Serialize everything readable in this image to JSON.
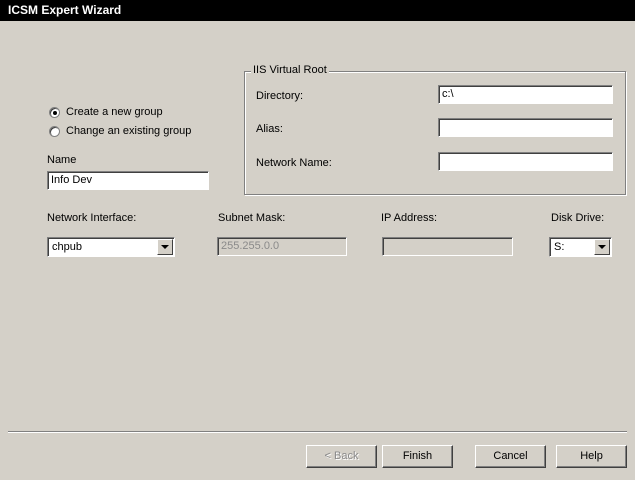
{
  "window": {
    "title": "ICSM Expert Wizard"
  },
  "group_choice": {
    "options": [
      {
        "label": "Create a new group",
        "selected": true
      },
      {
        "label": "Change an existing group",
        "selected": false
      }
    ]
  },
  "name": {
    "label": "Name",
    "value": "Info Dev"
  },
  "iis": {
    "title": "IIS Virtual Root",
    "directory_label": "Directory:",
    "directory_value": "c:\\",
    "alias_label": "Alias:",
    "alias_value": "",
    "network_name_label": "Network Name:",
    "network_name_value": ""
  },
  "network": {
    "interface_label": "Network Interface:",
    "interface_value": "chpub",
    "subnet_label": "Subnet Mask:",
    "subnet_value": "255.255.0.0",
    "ip_label": "IP Address:",
    "ip_value": "",
    "disk_label": "Disk Drive:",
    "disk_value": "S:"
  },
  "buttons": {
    "back": "< Back",
    "finish": "Finish",
    "cancel": "Cancel",
    "help": "Help"
  }
}
